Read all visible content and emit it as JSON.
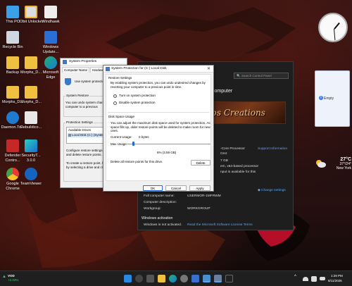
{
  "desktop": {
    "icons": [
      {
        "label": "This PC",
        "name": "this-pc"
      },
      {
        "label": "IObit Unlocker",
        "name": "iobit-unlocker"
      },
      {
        "label": "Windhawk",
        "name": "windhawk"
      },
      {
        "label": "Recycle Bin",
        "name": "recycle-bin"
      },
      {
        "label": "Windows Update...",
        "name": "windows-update"
      },
      {
        "label": "Backup",
        "name": "backup"
      },
      {
        "label": "Morphs_D...",
        "name": "morphs-d-1"
      },
      {
        "label": "Microsoft Edge",
        "name": "microsoft-edge"
      },
      {
        "label": "Morphs_D...",
        "name": "morphs-d-2"
      },
      {
        "label": "Morphs_D...",
        "name": "morphs-d-3"
      },
      {
        "label": "Daemon.To...",
        "name": "daemon-tools"
      },
      {
        "label": "Rebuildico...",
        "name": "rebuildicons"
      },
      {
        "label": "Defender Contro...",
        "name": "defender-control"
      },
      {
        "label": "SecurityT... 3.0.0",
        "name": "securityt"
      },
      {
        "label": "Google Chrome",
        "name": "google-chrome"
      },
      {
        "label": "TeamViewer",
        "name": "teamviewer"
      }
    ]
  },
  "gadgets": {
    "notes_label": "Empty",
    "weather": {
      "temp": "27°C",
      "range": "37°/24°",
      "location": "New York"
    }
  },
  "control_panel": {
    "search_placeholder": "Search Control Panel",
    "heading": "computer",
    "banner_text": "obs Creations",
    "processor_label": "-Core Processor",
    "support_link": "Support Information",
    "ghz": "GHz",
    "ram": "7 GB",
    "os_type": "em, x64-based processor",
    "pen_touch": "nput is available for this",
    "change_settings": "Change settings",
    "full_computer_name_label": "Full computer name:",
    "full_computer_name": "USERMOR-1MFRWM",
    "computer_description_label": "Computer description:",
    "workgroup_label": "Workgroup:",
    "workgroup": "WORKGROUP",
    "activation_heading": "Windows activation",
    "activation_status": "Windows is not activated.",
    "license_link": "Read the Microsoft Software License Terms"
  },
  "system_properties": {
    "title": "System Properties",
    "tabs": [
      "Computer Name",
      "Hardware"
    ],
    "use_protection_text": "Use system protectio",
    "system_restore_title": "System Restore",
    "restore_text": "You can undo system change your computer to a previous",
    "protection_settings_title": "Protection Settings",
    "available_drives_header": "Available Drives",
    "drive_item": "Local Disk (C:) (System",
    "configure_text": "Configure restore settings, m and delete restore points.",
    "create_text": "To create a restore point, fi by selecting a drive and clic"
  },
  "protection_dialog": {
    "title": "System Protection for (C:) Local Disk",
    "restore_settings_title": "Restore Settings",
    "restore_desc": "By enabling system protection, you can undo undesired changes by reverting your computer to a previous point in time.",
    "turn_on": "Turn on system protection",
    "disable": "Disable system protection",
    "disk_space_title": "Disk Space Usage",
    "disk_desc": "You can adjust the maximum disk space used for system protection. As space fills up, older restore points will be deleted to make room for new ones.",
    "current_usage_label": "Current Usage:",
    "current_usage_value": "0 bytes",
    "max_usage_label": "Max Usage:",
    "max_usage_value": "6% (3.59 GB)",
    "max_usage_fraction": 0.06,
    "delete_text": "Delete all restore points for this drive.",
    "delete_button": "Delete",
    "ok_button": "OK",
    "cancel_button": "Cancel",
    "apply_button": "Apply"
  },
  "taskbar": {
    "stock_label": "VOD",
    "stock_change": "+2.03%",
    "time": "1:29 PM",
    "date": "8/11/2026"
  },
  "colors": {
    "accent": "#1a6fd0",
    "link": "#5ba4f0",
    "taskbar": "#1f1f1f"
  }
}
